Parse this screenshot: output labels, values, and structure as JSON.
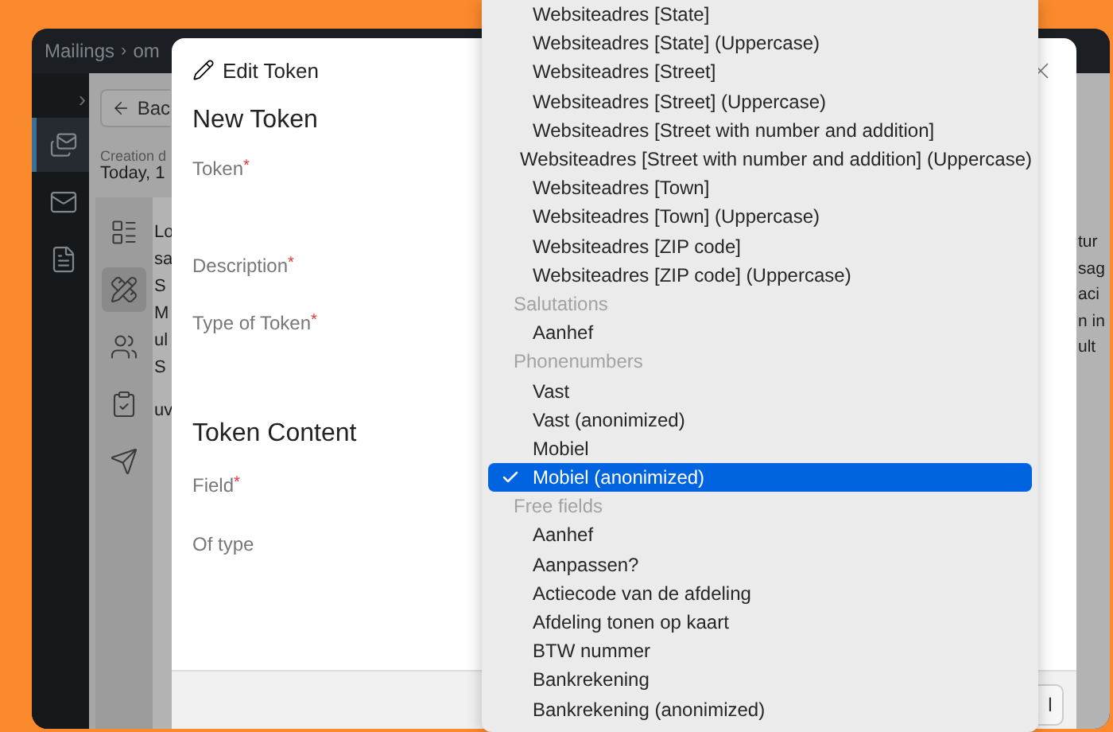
{
  "topbar": {
    "breadcrumb": [
      "Mailings",
      "om"
    ],
    "separator": "›"
  },
  "sidebar": {
    "expand": "›",
    "items": [
      {
        "kind": "mailings",
        "selected": true
      },
      {
        "kind": "mail",
        "selected": false
      },
      {
        "kind": "document",
        "selected": false
      }
    ]
  },
  "page": {
    "back_button": "Bac",
    "creation_label": "Creation d",
    "creation_value": "Today, 1",
    "tools": [
      {
        "kind": "list",
        "selected": false
      },
      {
        "kind": "design",
        "selected": true
      },
      {
        "kind": "people",
        "selected": false
      },
      {
        "kind": "check",
        "selected": false
      },
      {
        "kind": "send",
        "selected": false
      }
    ],
    "text_left": [
      [
        "Lo",
        "sa",
        "S",
        "M",
        "ul",
        "S"
      ],
      [
        "uv"
      ]
    ],
    "text_right": [
      "tur",
      "sag",
      "aci",
      "n in",
      "ult"
    ]
  },
  "modal": {
    "title": "Edit Token",
    "heading": "New Token",
    "fields": [
      {
        "label": "Token",
        "required": true
      },
      {
        "label": "Description",
        "required": true
      },
      {
        "label": "Type of Token",
        "required": true
      }
    ],
    "section": "Token Content",
    "content_fields": [
      {
        "label": "Field",
        "required": true
      },
      {
        "label": "Of type",
        "required": false
      }
    ],
    "required_mark": "*",
    "footer_button": "l"
  },
  "dropdown": [
    {
      "kind": "option",
      "label": "Websiteadres [State]",
      "selected": false
    },
    {
      "kind": "option",
      "label": "Websiteadres [State] (Uppercase)",
      "selected": false
    },
    {
      "kind": "option",
      "label": "Websiteadres [Street]",
      "selected": false
    },
    {
      "kind": "option",
      "label": "Websiteadres [Street] (Uppercase)",
      "selected": false
    },
    {
      "kind": "option",
      "label": "Websiteadres [Street with number and addition]",
      "selected": false
    },
    {
      "kind": "option",
      "label": "Websiteadres [Street with number and addition] (Uppercase)",
      "selected": false
    },
    {
      "kind": "option",
      "label": "Websiteadres [Town]",
      "selected": false
    },
    {
      "kind": "option",
      "label": "Websiteadres [Town] (Uppercase)",
      "selected": false
    },
    {
      "kind": "option",
      "label": "Websiteadres [ZIP code]",
      "selected": false
    },
    {
      "kind": "option",
      "label": "Websiteadres [ZIP code] (Uppercase)",
      "selected": false
    },
    {
      "kind": "group",
      "label": "Salutations"
    },
    {
      "kind": "option",
      "label": "Aanhef",
      "selected": false
    },
    {
      "kind": "group",
      "label": "Phonenumbers"
    },
    {
      "kind": "option",
      "label": "Vast",
      "selected": false
    },
    {
      "kind": "option",
      "label": "Vast (anonimized)",
      "selected": false
    },
    {
      "kind": "option",
      "label": "Mobiel",
      "selected": false
    },
    {
      "kind": "option",
      "label": "Mobiel (anonimized)",
      "selected": true
    },
    {
      "kind": "group",
      "label": "Free fields"
    },
    {
      "kind": "option",
      "label": "Aanhef",
      "selected": false
    },
    {
      "kind": "option",
      "label": "Aanpassen?",
      "selected": false
    },
    {
      "kind": "option",
      "label": "Actiecode van de afdeling",
      "selected": false
    },
    {
      "kind": "option",
      "label": "Afdeling tonen op kaart",
      "selected": false
    },
    {
      "kind": "option",
      "label": "BTW nummer",
      "selected": false
    },
    {
      "kind": "option",
      "label": "Bankrekening",
      "selected": false
    },
    {
      "kind": "option",
      "label": "Bankrekening (anonimized)",
      "selected": false
    }
  ]
}
